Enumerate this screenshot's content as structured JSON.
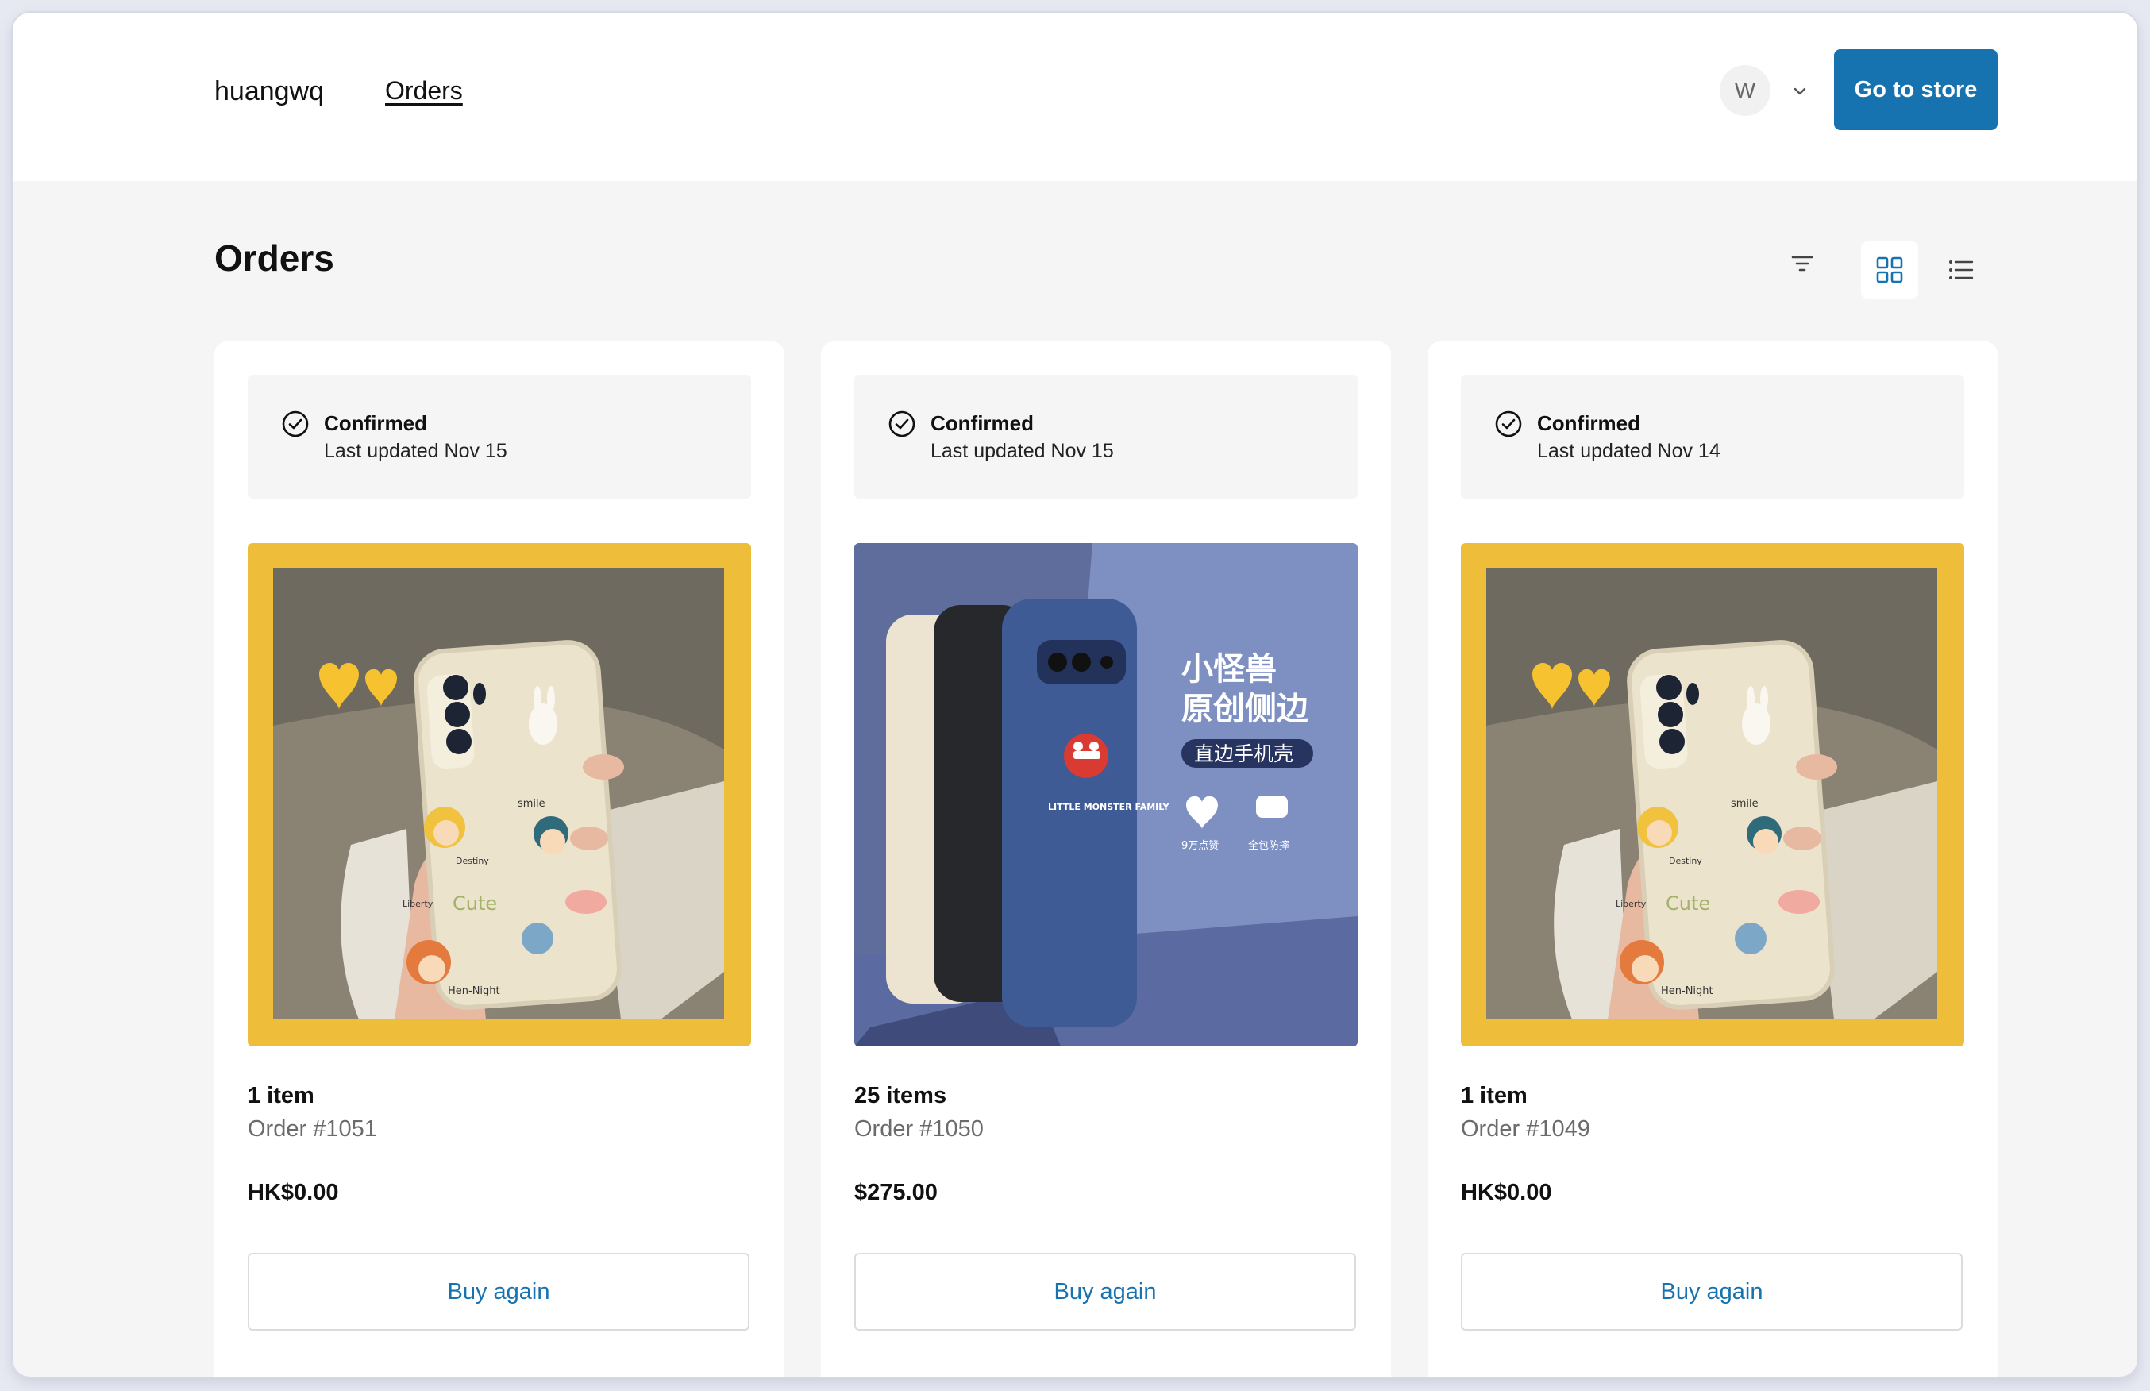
{
  "header": {
    "shop_name": "huangwq",
    "nav_orders": "Orders",
    "avatar_initial": "W",
    "store_button": "Go to store"
  },
  "page": {
    "title": "Orders"
  },
  "colors": {
    "accent": "#1773b0",
    "page_bg": "#f5f5f5",
    "thumb_yellow": "#eebd3a",
    "phone_blue": "#3f5b96"
  },
  "icons": [
    "chevron-down-icon",
    "filter-icon",
    "grid-view-icon",
    "list-view-icon",
    "check-circle-icon"
  ],
  "orders": [
    {
      "status": "Confirmed",
      "updated": "Last updated Nov 15",
      "items": "1 item",
      "order_number": "Order #1051",
      "total": "HK$0.00",
      "button": "Buy again",
      "thumbnail": "cream phone case with cartoon stickers on yellow background",
      "thumb_text": {
        "smile": "smile",
        "destiny": "Destiny",
        "liberty": "Liberty",
        "cute": "Cute",
        "hen": "Hen-Night"
      }
    },
    {
      "status": "Confirmed",
      "updated": "Last updated Nov 15",
      "items": "25 items",
      "order_number": "Order #1050",
      "total": "$275.00",
      "button": "Buy again",
      "thumbnail": "three little monster phone cases on blue background",
      "thumb_text": {
        "title1": "小怪兽",
        "title2": "原创侧边",
        "badge": "直边手机壳",
        "likes": "9万点赞",
        "protect": "全包防摔",
        "family": "LITTLE MONSTER FAMILY"
      }
    },
    {
      "status": "Confirmed",
      "updated": "Last updated Nov 14",
      "items": "1 item",
      "order_number": "Order #1049",
      "total": "HK$0.00",
      "button": "Buy again",
      "thumbnail": "cream phone case with cartoon stickers on yellow background",
      "thumb_text": {
        "smile": "smile",
        "destiny": "Destiny",
        "liberty": "Liberty",
        "cute": "Cute",
        "hen": "Hen-Night"
      }
    }
  ]
}
